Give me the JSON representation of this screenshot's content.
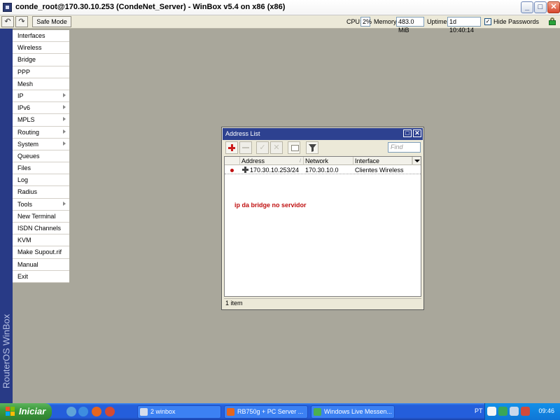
{
  "window": {
    "title": "conde_root@170.30.10.253 (CondeNet_Server) - WinBox v5.4 on x86 (x86)",
    "controls": {
      "minimize": "_",
      "maximize": "□",
      "close": "✕"
    }
  },
  "toolbar": {
    "undo_icon": "undo-icon",
    "redo_icon": "redo-icon",
    "safe_mode_label": "Safe Mode",
    "cpu_label": "CPU:",
    "cpu_value": "2%",
    "memory_label": "Memory:",
    "memory_value": "483.0 MiB",
    "uptime_label": "Uptime:",
    "uptime_value": "1d 10:40:14",
    "hide_passwords_label": "Hide Passwords",
    "hide_passwords_checked": true,
    "hide_passwords_mark": "✓"
  },
  "brand": {
    "text": "RouterOS WinBox",
    "color": "#283a86"
  },
  "sidebar": {
    "items": [
      {
        "label": "Interfaces",
        "submenu": false
      },
      {
        "label": "Wireless",
        "submenu": false
      },
      {
        "label": "Bridge",
        "submenu": false
      },
      {
        "label": "PPP",
        "submenu": false
      },
      {
        "label": "Mesh",
        "submenu": false
      },
      {
        "label": "IP",
        "submenu": true
      },
      {
        "label": "IPv6",
        "submenu": true
      },
      {
        "label": "MPLS",
        "submenu": true
      },
      {
        "label": "Routing",
        "submenu": true
      },
      {
        "label": "System",
        "submenu": true
      },
      {
        "label": "Queues",
        "submenu": false
      },
      {
        "label": "Files",
        "submenu": false
      },
      {
        "label": "Log",
        "submenu": false
      },
      {
        "label": "Radius",
        "submenu": false
      },
      {
        "label": "Tools",
        "submenu": true
      },
      {
        "label": "New Terminal",
        "submenu": false
      },
      {
        "label": "ISDN Channels",
        "submenu": false
      },
      {
        "label": "KVM",
        "submenu": false
      },
      {
        "label": "Make Supout.rif",
        "submenu": false
      },
      {
        "label": "Manual",
        "submenu": false
      },
      {
        "label": "Exit",
        "submenu": false
      }
    ]
  },
  "address_list": {
    "title": "Address List",
    "controls": {
      "restore": "□",
      "close": "✕"
    },
    "find_placeholder": "Find",
    "columns": {
      "address": "Address",
      "network": "Network",
      "interface": "Interface"
    },
    "rows": [
      {
        "address": "170.30.10.253/24",
        "network": "170.30.10.0",
        "interface": "Clientes Wireless"
      }
    ],
    "comment": "ip da bridge no servidor",
    "status": "1 item",
    "accent_color": "#c01010"
  },
  "taskbar": {
    "start_label": "Iniciar",
    "tasks": [
      {
        "label": "2 winbox"
      },
      {
        "label": "RB750g + PC Server ..."
      },
      {
        "label": "Windows Live Messen..."
      }
    ],
    "language": "PT",
    "clock": "09:46"
  }
}
